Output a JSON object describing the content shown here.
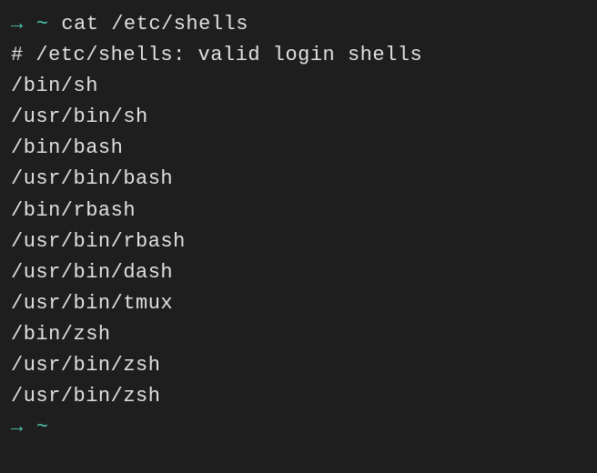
{
  "prompt1": {
    "arrow": "→",
    "tilde": "~",
    "command": "cat /etc/shells"
  },
  "output": {
    "comment": "# /etc/shells: valid login shells",
    "lines": [
      "/bin/sh",
      "/usr/bin/sh",
      "/bin/bash",
      "/usr/bin/bash",
      "/bin/rbash",
      "/usr/bin/rbash",
      "/usr/bin/dash",
      "/usr/bin/tmux",
      "/bin/zsh",
      "/usr/bin/zsh",
      "/usr/bin/zsh"
    ]
  },
  "prompt2": {
    "arrow": "→",
    "tilde": "~"
  }
}
